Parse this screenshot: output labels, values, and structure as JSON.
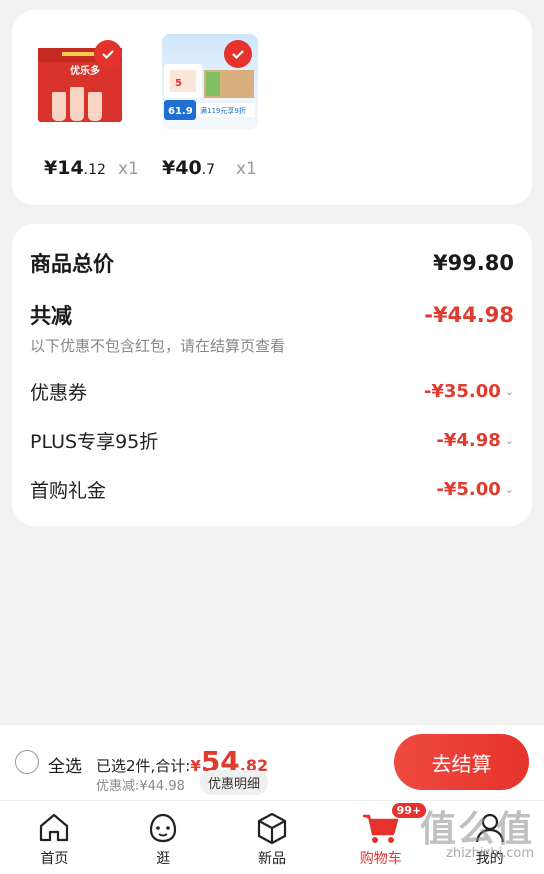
{
  "products": [
    {
      "price_int": "¥14",
      "price_dec": ".12",
      "qty": "x1",
      "image": "yogurt-drink-gift-box",
      "brand_text": "优乐多"
    },
    {
      "price_int": "¥40",
      "price_dec": ".7",
      "qty": "x1",
      "image": "drink-case-promo",
      "promo_price": "61.9",
      "promo_text": "满119元享9折"
    }
  ],
  "summary": {
    "total_label": "商品总价",
    "total_value": "¥99.80",
    "reduce_label": "共减",
    "reduce_value": "-¥44.98",
    "note": "以下优惠不包含红包，请在结算页查看",
    "items": [
      {
        "label": "优惠券",
        "value": "-¥35.00"
      },
      {
        "label": "PLUS专享95折",
        "value": "-¥4.98"
      },
      {
        "label": "首购礼金",
        "value": "-¥5.00"
      }
    ]
  },
  "checkout": {
    "select_all": "全选",
    "selected_text": "已选2件,合计:",
    "currency": "¥",
    "total_int": "54",
    "total_dec": ".82",
    "discount_text": "优惠减:¥44.98",
    "detail_button": "优惠明细",
    "pay_button": "去结算"
  },
  "tabs": [
    {
      "label": "首页",
      "icon": "home-icon"
    },
    {
      "label": "逛",
      "icon": "face-icon"
    },
    {
      "label": "新品",
      "icon": "cube-icon"
    },
    {
      "label": "购物车",
      "icon": "cart-icon",
      "badge": "99+",
      "active": true
    },
    {
      "label": "我的",
      "icon": "user-icon"
    }
  ],
  "watermark": {
    "big": "值么值",
    "small": "zhizhizhi.com"
  },
  "colors": {
    "accent": "#e5322d",
    "discount": "#e03b2f"
  }
}
